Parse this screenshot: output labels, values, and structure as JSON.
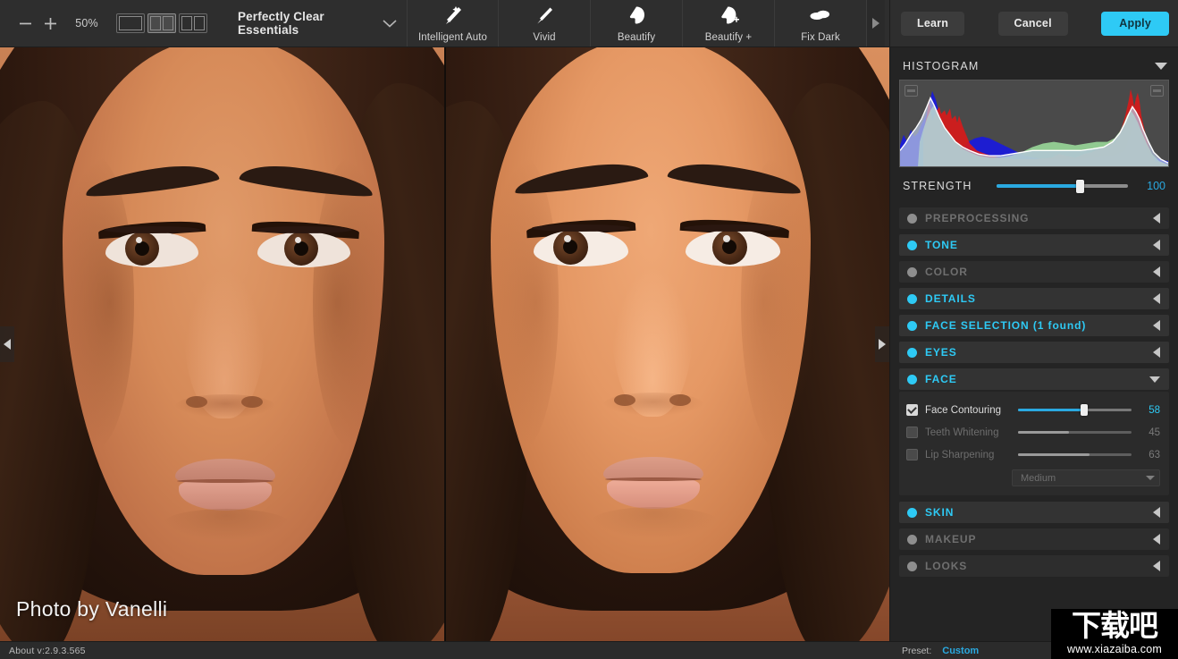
{
  "app": {
    "title": "Perfectly Clear Essentials",
    "version_label": "About v:2.9.3.565"
  },
  "toolbar": {
    "zoom_out_icon": "minus-icon",
    "zoom_in_icon": "plus-icon",
    "zoom_level": "50%",
    "view_modes": [
      {
        "name": "single-view",
        "icon": "single-pane-icon",
        "active": false
      },
      {
        "name": "split-view",
        "icon": "split-pane-icon",
        "active": true
      },
      {
        "name": "side-by-side-view",
        "icon": "two-pane-icon",
        "active": false
      }
    ],
    "preset_dropdown_icon": "chevron-down-icon",
    "tools": [
      {
        "label": "Intelligent Auto",
        "icon": "magic-wand-icon"
      },
      {
        "label": "Vivid",
        "icon": "brush-icon"
      },
      {
        "label": "Beautify",
        "icon": "face-icon"
      },
      {
        "label": "Beautify +",
        "icon": "face-plus-icon"
      },
      {
        "label": "Fix Dark",
        "icon": "cloud-icon"
      }
    ],
    "scroll_right_icon": "triangle-right-icon"
  },
  "actions": {
    "learn_label": "Learn",
    "cancel_label": "Cancel",
    "apply_label": "Apply",
    "apply_color": "#2ecaf5"
  },
  "canvas": {
    "photo_credit": "Photo by Vanelli",
    "left_handle_icon": "triangle-left-icon",
    "right_handle_icon": "triangle-right-icon"
  },
  "panel": {
    "histogram": {
      "title": "HISTOGRAM",
      "collapse_icon": "triangle-down-icon",
      "shadow_clip_icon": "shadow-clipping-icon",
      "highlight_clip_icon": "highlight-clipping-icon"
    },
    "strength": {
      "label": "STRENGTH",
      "value": "100",
      "percent": 63
    },
    "sections": [
      {
        "name": "preprocessing",
        "label": "PREPROCESSING",
        "enabled": false,
        "expanded": false,
        "arrow_icon": "triangle-left-icon"
      },
      {
        "name": "tone",
        "label": "TONE",
        "enabled": true,
        "expanded": false,
        "arrow_icon": "triangle-left-icon"
      },
      {
        "name": "color",
        "label": "COLOR",
        "enabled": false,
        "expanded": false,
        "arrow_icon": "triangle-left-icon"
      },
      {
        "name": "details",
        "label": "DETAILS",
        "enabled": true,
        "expanded": false,
        "arrow_icon": "triangle-left-icon"
      },
      {
        "name": "face-selection",
        "label": "FACE SELECTION (1 found)",
        "enabled": true,
        "expanded": false,
        "arrow_icon": "triangle-left-icon"
      },
      {
        "name": "eyes",
        "label": "EYES",
        "enabled": true,
        "expanded": false,
        "arrow_icon": "triangle-left-icon"
      },
      {
        "name": "face",
        "label": "FACE",
        "enabled": true,
        "expanded": true,
        "arrow_icon": "triangle-down-icon"
      }
    ],
    "face_controls": [
      {
        "name": "face-contouring",
        "label": "Face Contouring",
        "checked": true,
        "value": "58",
        "percent": 58
      },
      {
        "name": "teeth-whitening",
        "label": "Teeth Whitening",
        "checked": false,
        "value": "45",
        "percent": 45
      },
      {
        "name": "lip-sharpening",
        "label": "Lip Sharpening",
        "checked": false,
        "value": "63",
        "percent": 63
      }
    ],
    "face_dropdown": {
      "name": "lip-sharpening-amount",
      "value": "Medium",
      "icon": "chevron-down-icon"
    },
    "sections_bottom": [
      {
        "name": "skin",
        "label": "SKIN",
        "enabled": true,
        "arrow_icon": "triangle-left-icon"
      },
      {
        "name": "makeup",
        "label": "MAKEUP",
        "enabled": false,
        "arrow_icon": "triangle-left-icon"
      },
      {
        "name": "looks",
        "label": "LOOKS",
        "enabled": false,
        "arrow_icon": "triangle-left-icon"
      }
    ]
  },
  "status": {
    "about": "About v:2.9.3.565",
    "preset_label": "Preset:",
    "preset_value": "Custom"
  },
  "watermark": {
    "text_cn": "下载吧",
    "url": "www.xiazaiba.com"
  }
}
